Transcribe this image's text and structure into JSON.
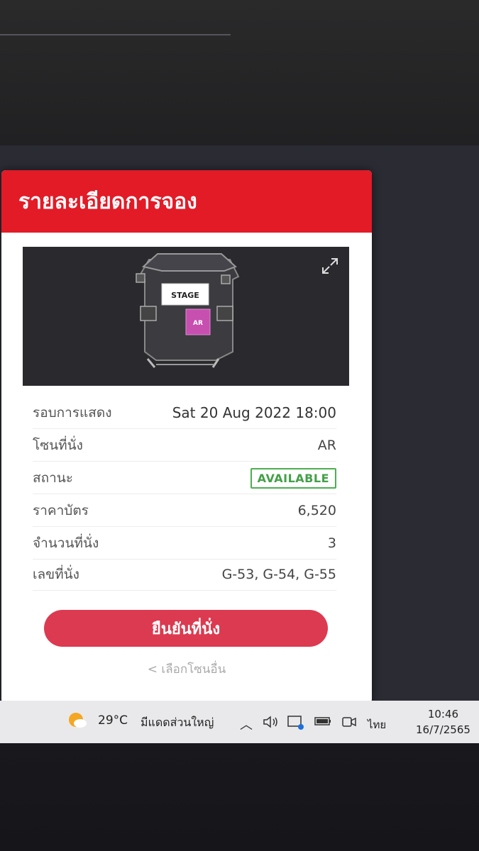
{
  "modal": {
    "title": "รายละเอียดการจอง",
    "map": {
      "stage_label": "STAGE",
      "zone_label": "AR",
      "expand_icon": "expand-icon"
    },
    "rows": [
      {
        "label": "รอบการแสดง",
        "value": "Sat 20 Aug 2022 18:00"
      },
      {
        "label": "โซนที่นั่ง",
        "value": "AR"
      },
      {
        "label": "สถานะ",
        "value": "AVAILABLE"
      },
      {
        "label": "ราคาบัตร",
        "value": "6,520"
      },
      {
        "label": "จำนวนที่นั่ง",
        "value": "3"
      },
      {
        "label": "เลขที่นั่ง",
        "value": "G-53, G-54, G-55"
      }
    ],
    "confirm_button": "ยืนยันที่นั่ง",
    "other_zone_link": "< เลือกโซนอื่น"
  },
  "taskbar": {
    "temperature": "29°C",
    "weather": "มีแดดส่วนใหญ่",
    "language": "ไทย",
    "time": "10:46",
    "date": "16/7/2565"
  },
  "colors": {
    "header_red": "#e21b27",
    "button_red": "#dc3a50",
    "available_green": "#4caf50",
    "zone_magenta": "#c74fb0"
  }
}
